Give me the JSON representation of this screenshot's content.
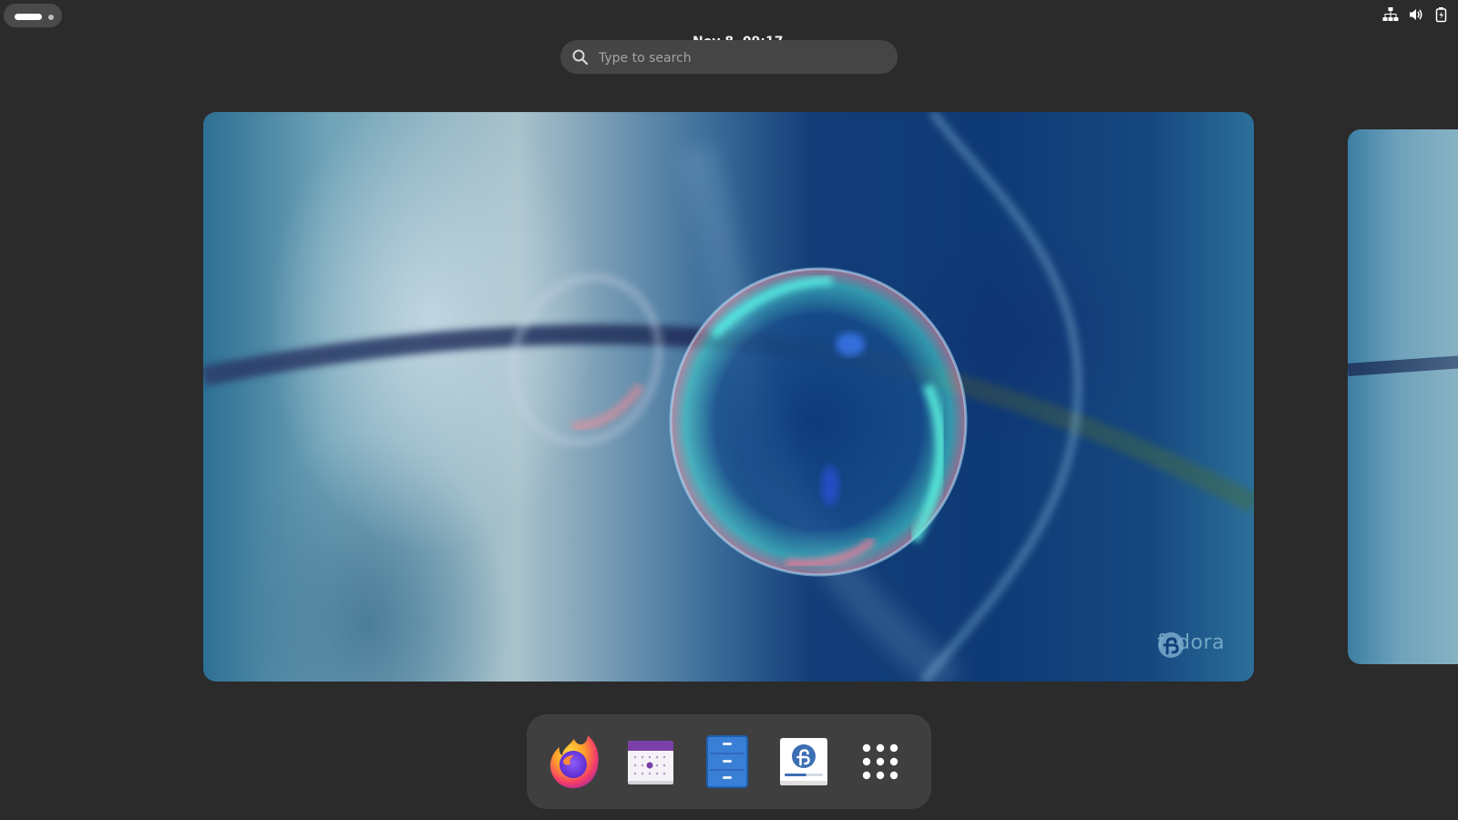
{
  "topbar": {
    "activities_icon": "activities-indicator",
    "clock": "Nov 8  09:17",
    "tray_icons": [
      "network-icon",
      "volume-icon",
      "battery-icon"
    ]
  },
  "search": {
    "placeholder": "Type to search",
    "value": "",
    "icon": "search-icon"
  },
  "workspace": {
    "wallpaper_brand": "fedora",
    "wallpaper_brand_icon": "fedora-logo-icon"
  },
  "dash": {
    "items": [
      {
        "name": "Firefox",
        "icon": "firefox-icon"
      },
      {
        "name": "Calendar",
        "icon": "calendar-icon"
      },
      {
        "name": "Files",
        "icon": "files-icon"
      },
      {
        "name": "Fedora Media Writer",
        "icon": "fedora-installer-icon"
      },
      {
        "name": "Show Apps",
        "icon": "app-grid-icon"
      }
    ]
  },
  "colors": {
    "background": "#2b2b2b",
    "search_bg": "#454545",
    "dash_bg": "#3f3f3f",
    "calendar_accent": "#7b3fa8",
    "files_blue": "#3a7fd6"
  }
}
